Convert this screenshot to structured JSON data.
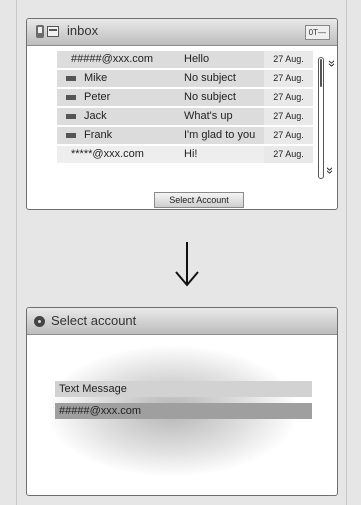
{
  "inbox": {
    "title": "inbox",
    "status": "0T—",
    "rows": [
      {
        "sender": "#####@xxx.com",
        "subject": "Hello",
        "date": "27 Aug."
      },
      {
        "sender": "Mike",
        "subject": "No subject",
        "date": "27 Aug."
      },
      {
        "sender": "Peter",
        "subject": "No subject",
        "date": "27 Aug."
      },
      {
        "sender": "Jack",
        "subject": "What's up",
        "date": "27 Aug."
      },
      {
        "sender": "Frank",
        "subject": "I'm glad to you",
        "date": "27 Aug."
      },
      {
        "sender": "*****@xxx.com",
        "subject": "Hi!",
        "date": "27 Aug."
      }
    ],
    "scroll_up_glyph": "«",
    "scroll_down_glyph": "»",
    "button_label": "Select Account"
  },
  "select_account": {
    "title": "Select account",
    "options": [
      "Text Message",
      "#####@xxx.com"
    ],
    "selected_index": 1
  },
  "colors": {
    "frame_bg": "#e6e6e6",
    "titlebar_top": "#e9e9e9",
    "titlebar_bottom": "#bdbdbd",
    "selected_option": "#9f9f9f"
  },
  "icons": [
    "phone-icon",
    "inbox-icon",
    "envelope-icon",
    "gear-icon",
    "arrow-down-icon"
  ]
}
